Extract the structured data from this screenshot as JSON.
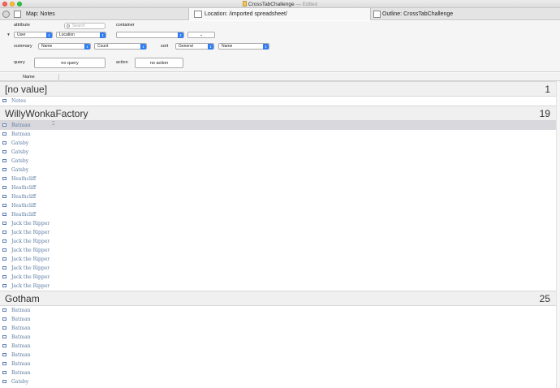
{
  "window": {
    "title": "CrossTabChallenge",
    "edited": "— Edited"
  },
  "tabs": [
    {
      "label": "Map: Notes"
    },
    {
      "label": "Location: /imported spreadsheet/"
    },
    {
      "label": "Outline: CrossTabChallenge"
    }
  ],
  "panel": {
    "attribute_label": "attribute",
    "container_label": "container",
    "search_placeholder": "Search",
    "attribute_value": "User",
    "attribute2_value": "Location",
    "container_value": "",
    "summary_label": "summary",
    "summary_value": "Name",
    "summary_op": "Count",
    "sort_label": "sort",
    "sort_value": "General",
    "sort_field": "Name",
    "query_label": "query",
    "query_button": "no query",
    "action_label": "action",
    "action_button": "no action"
  },
  "column": {
    "name": "Name"
  },
  "groups": [
    {
      "name": "[no value]",
      "count": "1",
      "rows": [
        "Notes"
      ]
    },
    {
      "name": "WillyWonkaFactory",
      "count": "19",
      "rows": [
        "Batman",
        "Batman",
        "Gatsby",
        "Gatsby",
        "Gatsby",
        "Gatsby",
        "Heathcliff",
        "Heathcliff",
        "Heathcliff",
        "Heathcliff",
        "Heathcliff",
        "Jack the Ripper",
        "Jack the Ripper",
        "Jack the Ripper",
        "Jack the Ripper",
        "Jack the Ripper",
        "Jack the Ripper",
        "Jack the Ripper",
        "Jack the Ripper"
      ]
    },
    {
      "name": "Gotham",
      "count": "25",
      "rows": [
        "Batman",
        "Batman",
        "Batman",
        "Batman",
        "Batman",
        "Batman",
        "Batman",
        "Batman",
        "Gatsby"
      ]
    }
  ],
  "selected": {
    "group": 1,
    "row": 0
  },
  "colors": {
    "accent": "#2f7cf6",
    "note_text": "#5a7aa0",
    "selection": "#d8d8dc"
  },
  "icons": {
    "note": "note-icon",
    "search": "search-icon",
    "disclosure": "disclosure-triangle-icon"
  }
}
